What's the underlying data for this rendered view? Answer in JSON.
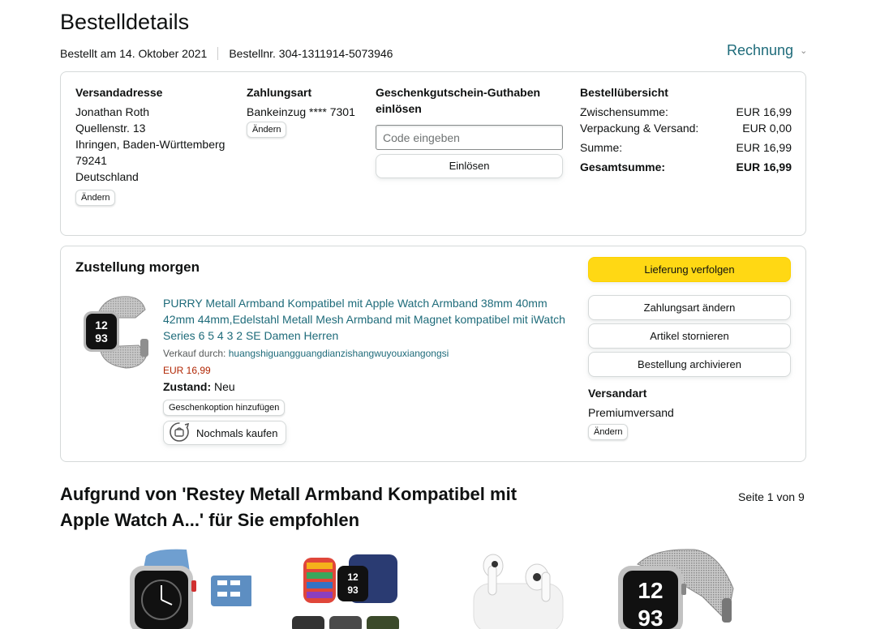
{
  "page": {
    "title": "Bestelldetails"
  },
  "meta": {
    "ordered": "Bestellt am 14. Oktober 2021",
    "order_number": "Bestellnr. 304-1311914-5073946",
    "invoice_label": "Rechnung"
  },
  "shipping_address": {
    "title": "Versandadresse",
    "lines": [
      "Jonathan Roth",
      "Quellenstr. 13",
      "Ihringen, Baden-Württemberg",
      "79241",
      "Deutschland"
    ],
    "change_label": "Ändern"
  },
  "payment": {
    "title": "Zahlungsart",
    "method": "Bankeinzug **** 7301",
    "change_label": "Ändern"
  },
  "gift_card": {
    "title": "Geschenkgutschein-Guthaben einlösen",
    "placeholder": "Code eingeben",
    "redeem_label": "Einlösen"
  },
  "summary": {
    "title": "Bestellübersicht",
    "rows": [
      {
        "label": "Zwischensumme:",
        "value": "EUR 16,99"
      },
      {
        "label": "Verpackung & Versand:",
        "value": "EUR 0,00"
      },
      {
        "label": "Summe:",
        "value": "EUR 16,99"
      }
    ],
    "total_label": "Gesamtsumme:",
    "total_value": "EUR 16,99"
  },
  "delivery": {
    "title": "Zustellung morgen",
    "product": {
      "name": "PURRY Metall Armband Kompatibel mit Apple Watch Armband 38mm 40mm 42mm 44mm,Edelstahl Metall Mesh Armband mit Magnet kompatibel mit iWatch Series 6 5 4 3 2 SE Damen Herren",
      "seller_prefix": "Verkauf durch: ",
      "seller": "huangshiguangguangdianzishangwuyouxiangongsi",
      "price": "EUR 16,99",
      "condition_label": "Zustand:",
      "condition_value": "Neu",
      "gift_option_label": "Geschenkoption hinzufügen",
      "buy_again_label": "Nochmals kaufen"
    },
    "actions": {
      "track": "Lieferung verfolgen",
      "change_payment": "Zahlungsart ändern",
      "cancel": "Artikel stornieren",
      "archive": "Bestellung archivieren"
    },
    "shipping_type_title": "Versandart",
    "shipping_type": "Premiumversand",
    "change_label": "Ändern"
  },
  "recommendations": {
    "title": "Aufgrund von 'Restey Metall Armband Kompatibel mit Apple Watch A...' für Sie empfohlen",
    "page_indicator": "Seite 1 von 9"
  },
  "colors": {
    "link": "#1e6b7a",
    "primary_button": "#ffd814",
    "price": "#b12704",
    "border": "#d5d9d9"
  }
}
